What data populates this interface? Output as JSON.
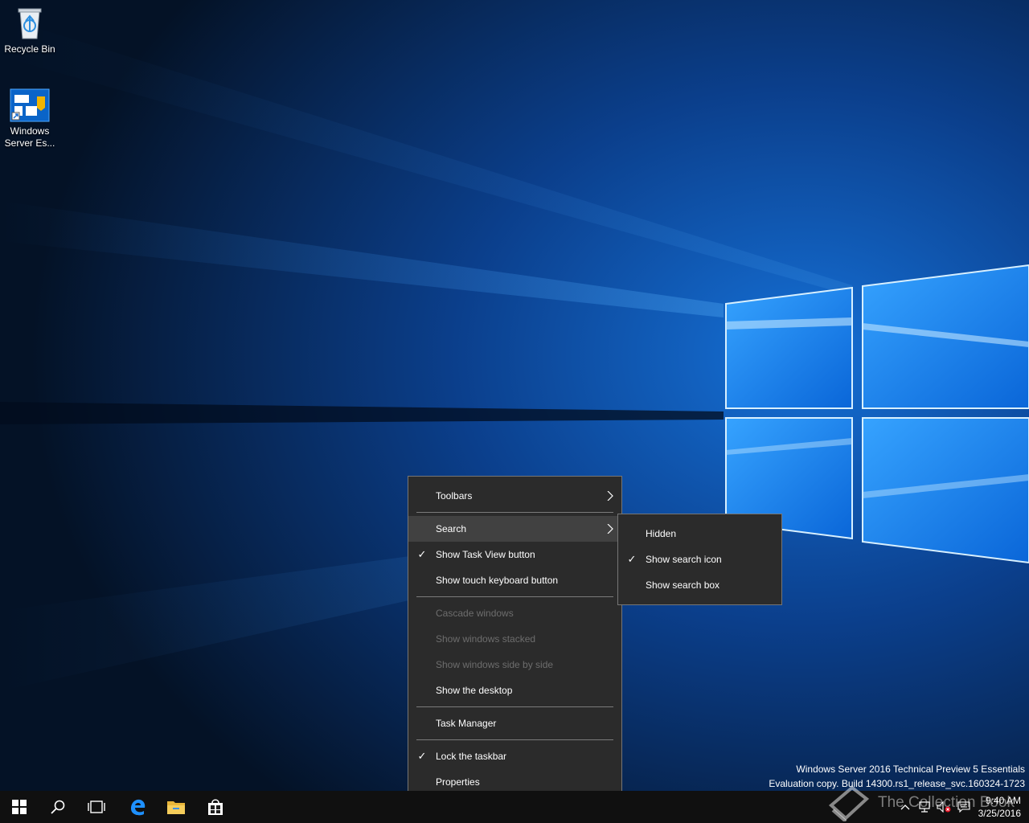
{
  "desktop": {
    "icons": [
      {
        "label": "Recycle Bin"
      },
      {
        "label_line1": "Windows",
        "label_line2": "Server Es..."
      }
    ]
  },
  "context_menu": {
    "items": [
      {
        "label": "Toolbars",
        "submenu": true
      },
      {
        "label": "Search",
        "submenu": true,
        "highlighted": true
      },
      {
        "label": "Show Task View button",
        "checked": true
      },
      {
        "label": "Show touch keyboard button"
      },
      {
        "label": "Cascade windows",
        "disabled": true
      },
      {
        "label": "Show windows stacked",
        "disabled": true
      },
      {
        "label": "Show windows side by side",
        "disabled": true
      },
      {
        "label": "Show the desktop"
      },
      {
        "label": "Task Manager"
      },
      {
        "label": "Lock the taskbar",
        "checked": true
      },
      {
        "label": "Properties"
      }
    ]
  },
  "search_submenu": {
    "items": [
      {
        "label": "Hidden"
      },
      {
        "label": "Show search icon",
        "checked": true
      },
      {
        "label": "Show search box"
      }
    ]
  },
  "watermark": {
    "line1": "Windows Server 2016 Technical Preview 5 Essentials",
    "line2": "Evaluation copy. Build 14300.rs1_release_svc.160324-1723"
  },
  "taskbar": {
    "buttons": [
      "windows-logo-icon",
      "search-icon",
      "task-view-icon",
      "edge-icon",
      "file-explorer-icon",
      "store-icon"
    ],
    "tray": {
      "time": "9:40 AM",
      "date": "3/25/2016",
      "icons": [
        "chevron-up-icon",
        "network-icon",
        "volume-muted-icon",
        "action-center-icon"
      ]
    }
  },
  "overlay": {
    "brand_text": "The Collection Book"
  },
  "colors": {
    "accent": "#0078d7",
    "menu_bg": "#2b2b2b",
    "menu_highlight": "#414141",
    "taskbar_bg": "#101010"
  }
}
